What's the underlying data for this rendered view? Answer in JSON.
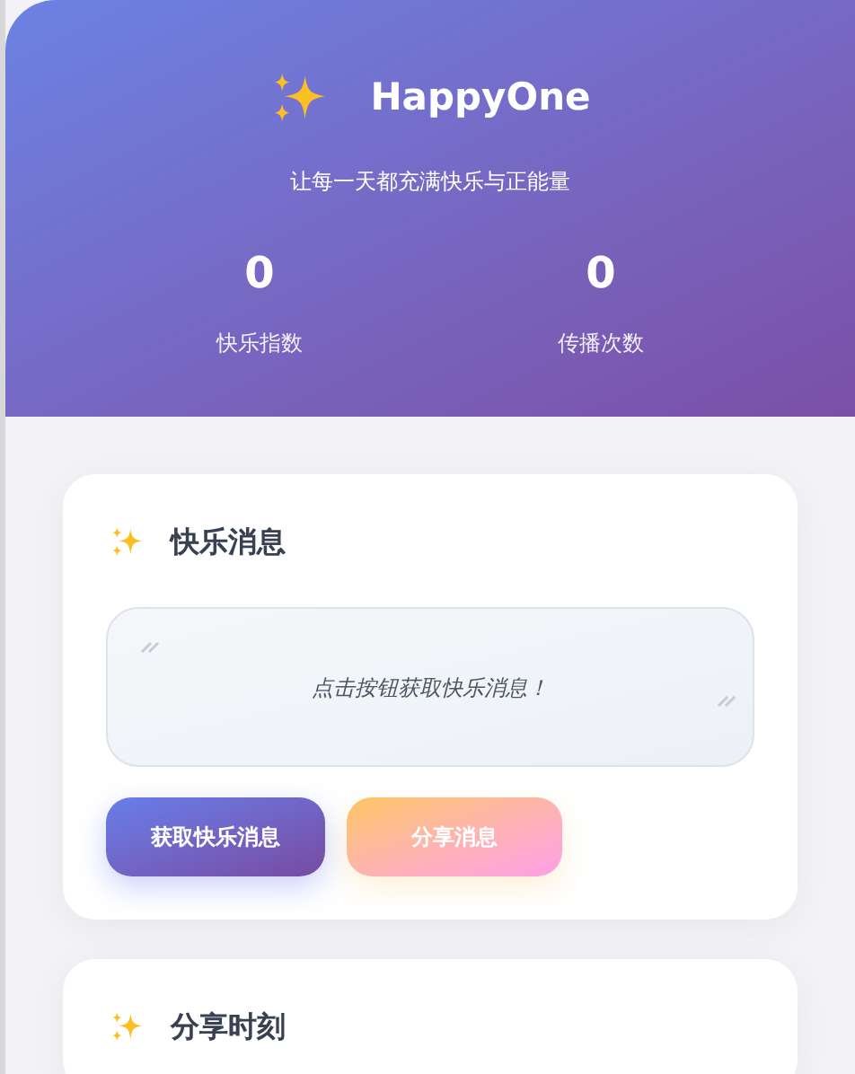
{
  "header": {
    "title": "HappyOne",
    "subtitle": "让每一天都充满快乐与正能量",
    "stats": [
      {
        "value": "0",
        "label": "快乐指数"
      },
      {
        "value": "0",
        "label": "传播次数"
      }
    ]
  },
  "cards": [
    {
      "title": "快乐消息",
      "message": "点击按钮获取快乐消息！",
      "buttons": [
        {
          "label": "获取快乐消息",
          "kind": "primary"
        },
        {
          "label": "分享消息",
          "kind": "secondary"
        }
      ]
    },
    {
      "title": "分享时刻"
    }
  ]
}
